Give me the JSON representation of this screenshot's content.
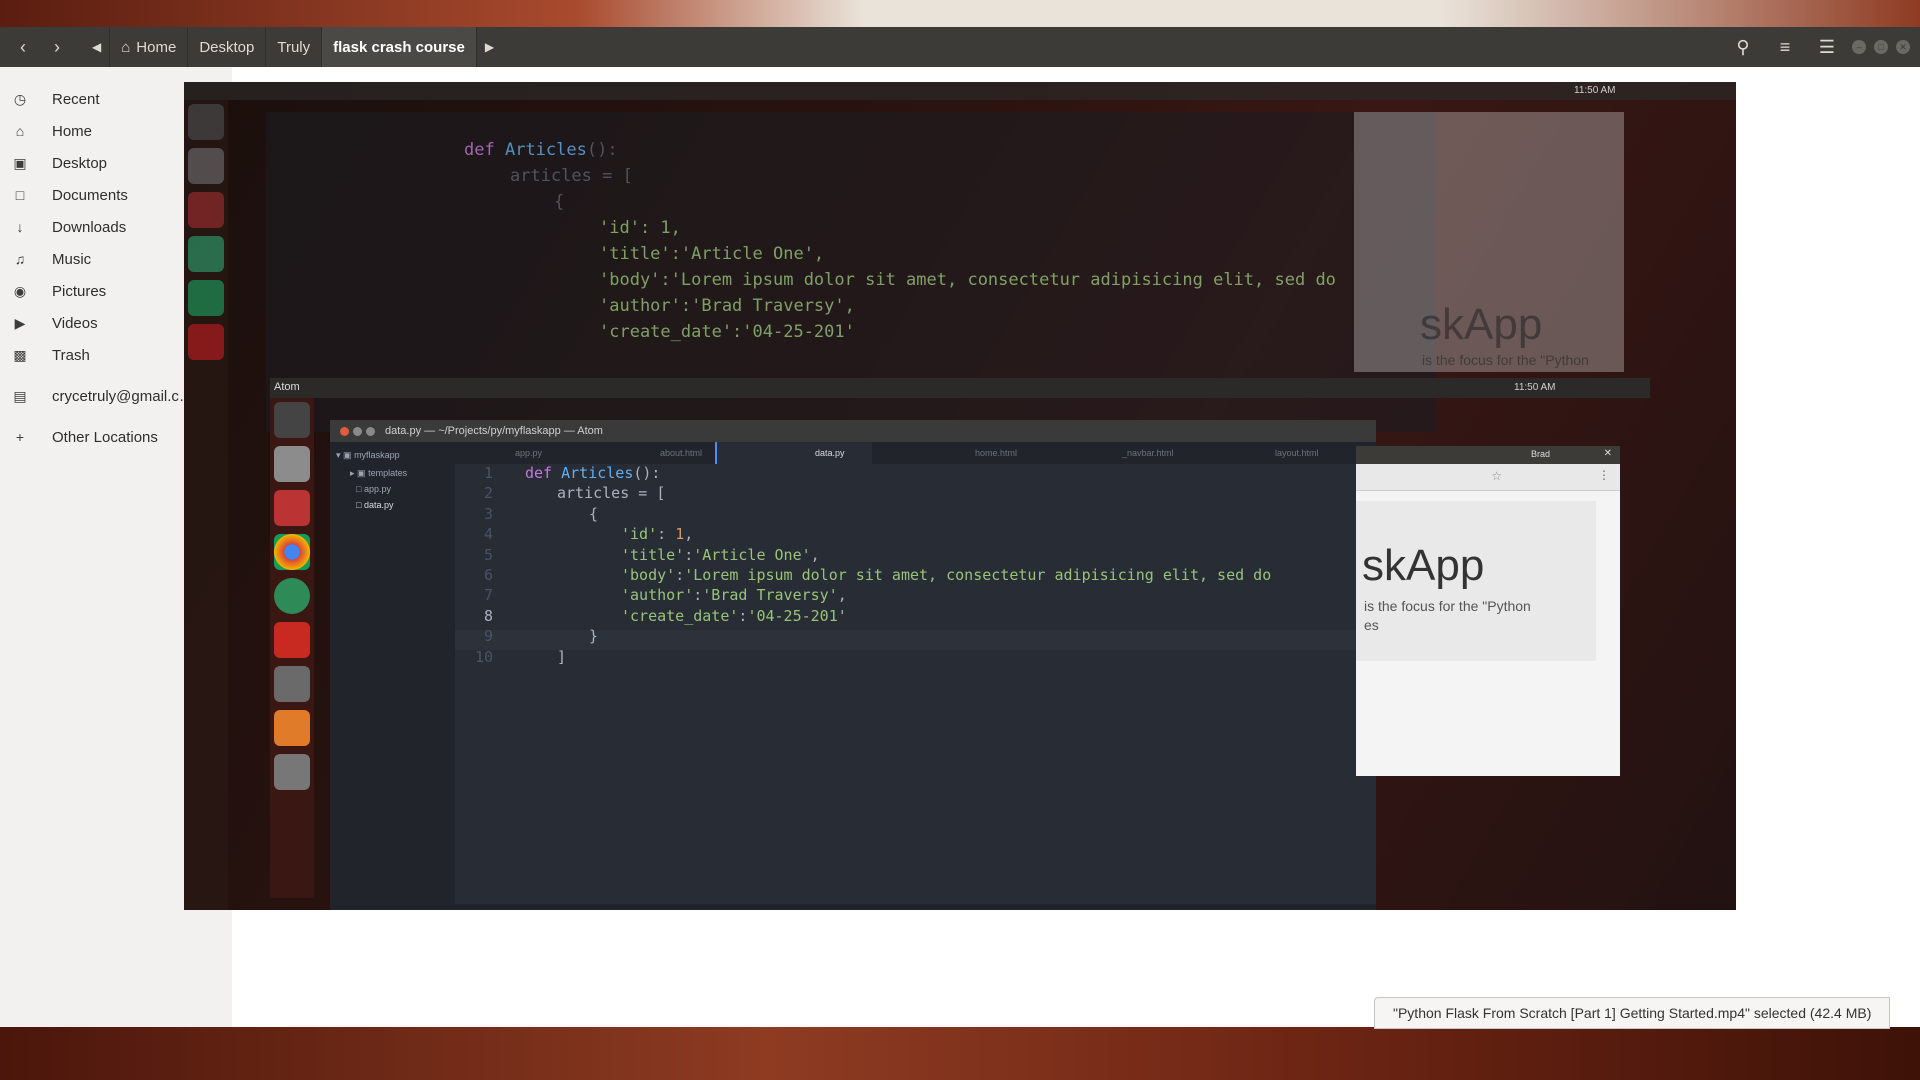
{
  "files": {
    "breadcrumbs": [
      "Home",
      "Desktop",
      "Truly",
      "flask crash course"
    ],
    "places": [
      {
        "label": "Recent",
        "icon": "clock-icon"
      },
      {
        "label": "Home",
        "icon": "home-icon"
      },
      {
        "label": "Desktop",
        "icon": "folder-icon"
      },
      {
        "label": "Documents",
        "icon": "document-icon"
      },
      {
        "label": "Downloads",
        "icon": "download-icon"
      },
      {
        "label": "Music",
        "icon": "music-icon"
      },
      {
        "label": "Pictures",
        "icon": "camera-icon"
      },
      {
        "label": "Videos",
        "icon": "video-icon"
      },
      {
        "label": "Trash",
        "icon": "trash-icon"
      },
      {
        "label": "crycetruly@gmail.c…",
        "icon": "network-icon"
      },
      {
        "label": "Other Locations",
        "icon": "plus-icon"
      }
    ],
    "status": "\"Python Flask From Scratch [Part 1] Getting Started.mp4\" selected  (42.4 MB)"
  },
  "preview": {
    "topbar_label": "Atom",
    "clock": "11:50 AM",
    "atom": {
      "title": "data.py — ~/Projects/py/myflaskapp — Atom",
      "tree": {
        "root": "myflaskapp",
        "items": [
          "templates",
          "app.py",
          "data.py"
        ]
      },
      "tabs": [
        "app.py",
        "about.html",
        "data.py",
        "home.html",
        "_navbar.html",
        "layout.html"
      ],
      "line_numbers": [
        "1",
        "2",
        "3",
        "4",
        "5",
        "6",
        "7",
        "8",
        "9",
        "10"
      ],
      "code": {
        "l1_kw": "def",
        "l1_fn": "Articles",
        "l1_rest": "():",
        "l2": "articles = [",
        "l3": "{",
        "l4_key": "'id'",
        "l4_sep": ": ",
        "l4_num": "1",
        "l4_end": ",",
        "l5_key": "'title'",
        "l5_sep": ":",
        "l5_val": "'Article One'",
        "l5_end": ",",
        "l6_key": "'body'",
        "l6_sep": ":",
        "l6_val": "'Lorem ipsum dolor sit amet, consectetur adipisicing elit, sed do",
        "l7_key": "'author'",
        "l7_sep": ":",
        "l7_val": "'Brad Traversy'",
        "l7_end": ",",
        "l8_key": "'create_date'",
        "l8_sep": ":",
        "l8_val": "'04-25-201'",
        "l9": "}",
        "l10": "]"
      }
    },
    "browser": {
      "user": "Brad",
      "hero_title": "skApp",
      "hero_sub_1": "is the focus for the \"Python",
      "hero_sub_2": "es"
    }
  }
}
